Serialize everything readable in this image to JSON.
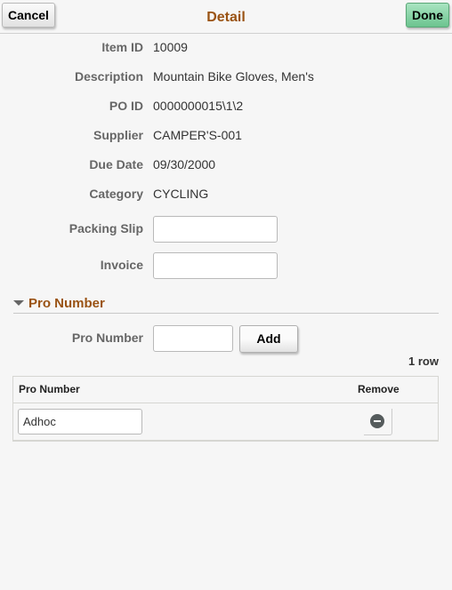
{
  "header": {
    "title": "Detail",
    "cancel_label": "Cancel",
    "done_label": "Done"
  },
  "fields": [
    {
      "label": "Item ID",
      "value": "10009"
    },
    {
      "label": "Description",
      "value": "Mountain Bike Gloves, Men's"
    },
    {
      "label": "PO ID",
      "value": "0000000015\\1\\2"
    },
    {
      "label": "Supplier",
      "value": "CAMPER'S-001"
    },
    {
      "label": "Due Date",
      "value": "09/30/2000"
    },
    {
      "label": "Category",
      "value": "CYCLING"
    }
  ],
  "inputs": {
    "packing_slip": {
      "label": "Packing Slip",
      "value": ""
    },
    "invoice": {
      "label": "Invoice",
      "value": ""
    }
  },
  "pro_section": {
    "title": "Pro Number",
    "input_label": "Pro Number",
    "input_value": "",
    "add_label": "Add",
    "row_count": "1 row",
    "grid": {
      "columns": [
        "Pro Number",
        "Remove"
      ],
      "rows": [
        {
          "pro_number": "Adhoc",
          "remove_icon": "minus-circle-icon"
        }
      ]
    }
  }
}
